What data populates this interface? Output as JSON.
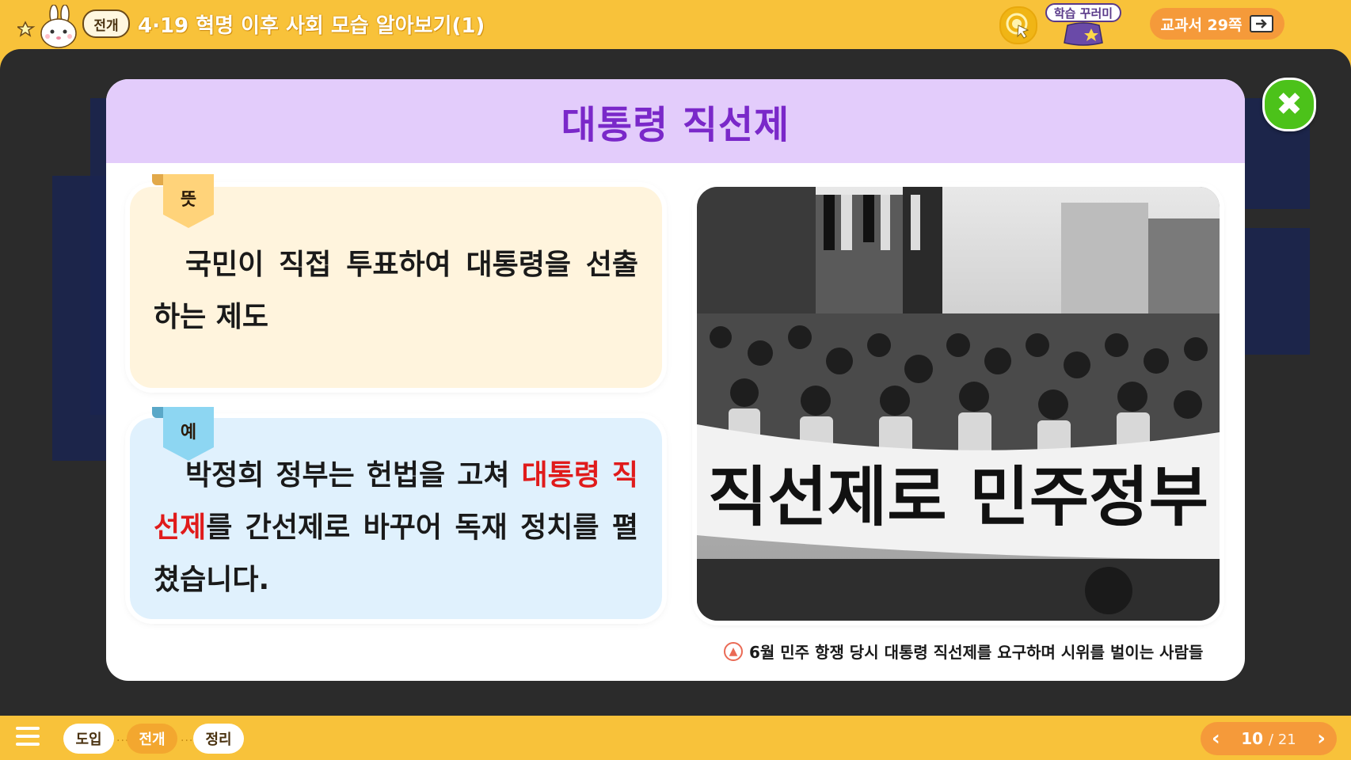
{
  "header": {
    "stage_badge": "전개",
    "title": "4·19 혁명 이후 사회 모습 알아보기(1)",
    "dictionary_label": "학습 꾸러미",
    "textbook_label": "교과서 29쪽"
  },
  "modal": {
    "title": "대통령 직선제",
    "meaning": {
      "tag": "뜻",
      "text": "국민이 직접 투표하여 대통령을 선출하는 제도"
    },
    "example": {
      "tag": "예",
      "text_before": "박정희 정부는 헌법을 고쳐 ",
      "highlight": "대통령 직선제",
      "text_after": "를 간선제로 바꾸어 독재 정치를 펼쳤습니다."
    },
    "photo_banner_text": "직선제로 민주정부",
    "caption": "6월 민주 항쟁 당시 대통령 직선제를 요구하며 시위를 벌이는 사람들"
  },
  "footer": {
    "steps": [
      "도입",
      "전개",
      "정리"
    ],
    "active_step": 1,
    "current_page": "10",
    "total_pages": "/ 21"
  },
  "colors": {
    "header_bg": "#f8c23a",
    "modal_header_bg": "#e3ccfb",
    "modal_title": "#7a28c9",
    "highlight": "#e01b1b",
    "close_button": "#4cc21a"
  },
  "icons": [
    "rabbit-mascot-icon",
    "pointer-icon",
    "book-icon",
    "close-icon",
    "menu-icon",
    "chevron-left-icon",
    "chevron-right-icon",
    "caption-arrow-icon"
  ]
}
